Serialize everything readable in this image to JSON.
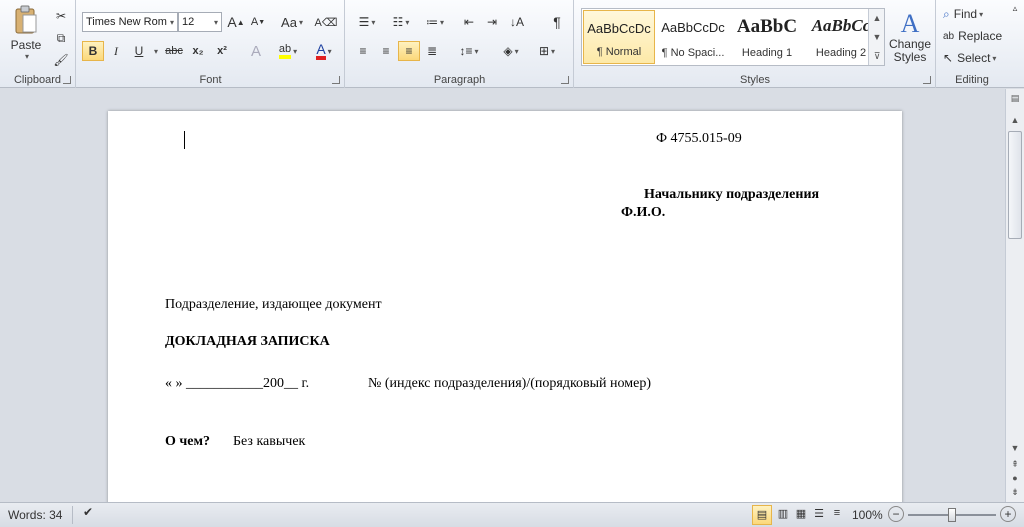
{
  "ribbon": {
    "clipboard": {
      "label": "Clipboard",
      "paste": "Paste"
    },
    "font": {
      "label": "Font",
      "font_name": "Times New Rom",
      "font_size": "12",
      "change_case": "Aa",
      "bold": "B",
      "italic": "I",
      "underline": "U",
      "strike": "abc",
      "subscript": "x₂",
      "superscript": "x²",
      "text_effects": "A",
      "highlight": "ab",
      "font_color": "A",
      "grow": "A",
      "shrink": "A"
    },
    "paragraph": {
      "label": "Paragraph",
      "show_marks": "¶"
    },
    "styles": {
      "label": "Styles",
      "tiles": [
        {
          "preview": "AaBbCcDc",
          "name": "¶ Normal"
        },
        {
          "preview": "AaBbCcDc",
          "name": "¶ No Spaci..."
        },
        {
          "preview": "AaBbC",
          "name": "Heading 1"
        },
        {
          "preview": "AaBbCc",
          "name": "Heading 2"
        }
      ],
      "change_styles": "Change\nStyles"
    },
    "editing": {
      "label": "Editing",
      "find": "Find",
      "replace": "Replace",
      "select": "Select"
    }
  },
  "document": {
    "form_code": "Ф 4755.015-09",
    "addressee_line1": "Начальнику  подразделения",
    "addressee_line2": "Ф.И.О.",
    "department": "Подразделение,  издающее документ",
    "doc_title": "ДОКЛАДНАЯ ЗАПИСКА",
    "date_line": "«     » ___________200__ г.",
    "number_line": "№ (индекс подразделения)/(порядковый номер)",
    "subject_label": "О чем?",
    "subject_text": "Без кавычек"
  },
  "status": {
    "words": "Words: 34",
    "zoom": "100%"
  },
  "colors": {
    "accent": "#e7b54a",
    "highlight_yellow": "#ffff00",
    "font_red": "#e02020"
  }
}
